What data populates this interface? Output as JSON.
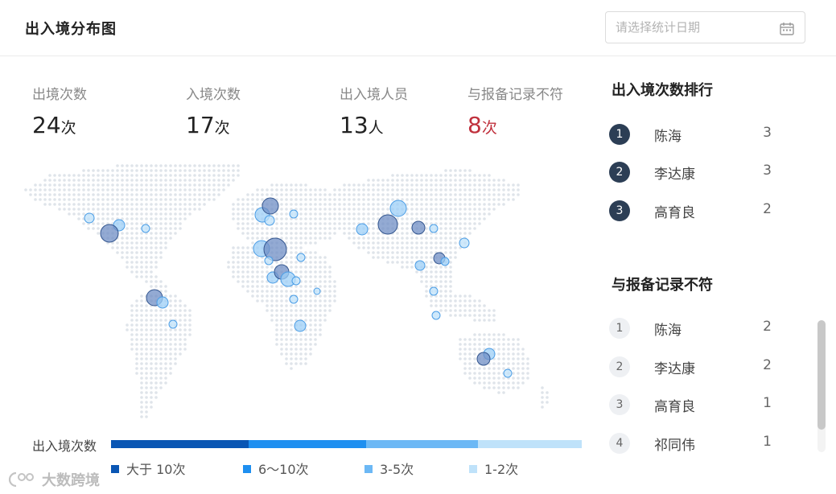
{
  "header": {
    "title": "出入境分布图",
    "date_placeholder": "请选择统计日期"
  },
  "stats": [
    {
      "label": "出境次数",
      "value": "24",
      "unit": "次"
    },
    {
      "label": "入境次数",
      "value": "17",
      "unit": "次"
    },
    {
      "label": "出入境人员",
      "value": "13",
      "unit": "人"
    },
    {
      "label": "与报备记录不符",
      "value": "8",
      "unit": "次"
    }
  ],
  "legend": {
    "title": "出入境次数",
    "items": [
      {
        "label": "大于 10次",
        "color": "#0a56b4"
      },
      {
        "label": "6～10次",
        "color": "#1e8ff0"
      },
      {
        "label": "3-5次",
        "color": "#6cb8f5"
      },
      {
        "label": "1-2次",
        "color": "#bfe2fa"
      }
    ]
  },
  "ranking": {
    "title": "出入境次数排行",
    "rows": [
      {
        "rank": "1",
        "name": "陈海",
        "count": "3"
      },
      {
        "rank": "2",
        "name": "李达康",
        "count": "3"
      },
      {
        "rank": "3",
        "name": "高育良",
        "count": "2"
      }
    ]
  },
  "mismatch": {
    "title": "与报备记录不符",
    "rows": [
      {
        "rank": "1",
        "name": "陈海",
        "count": "2"
      },
      {
        "rank": "2",
        "name": "李达康",
        "count": "2"
      },
      {
        "rank": "3",
        "name": "高育良",
        "count": "1"
      },
      {
        "rank": "4",
        "name": "祁同伟",
        "count": "1"
      }
    ]
  },
  "watermark": {
    "text": "大数跨境"
  },
  "colors": {
    "accent_dark": "#2c3e55",
    "warn": "#c0313d",
    "map_dot": "#dfe4ea"
  },
  "icons": {
    "date": "calendar-icon",
    "map": "world-dot-map"
  }
}
